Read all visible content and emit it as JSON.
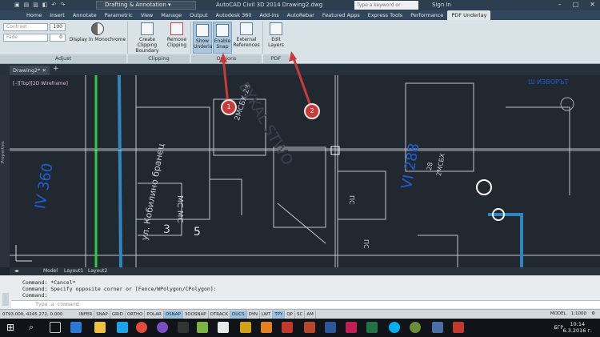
{
  "window": {
    "title": "AutoCAD Civil 3D 2014   Drawing2.dwg",
    "workspace": "Drafting & Annotation",
    "search_placeholder": "Type a keyword or phrase",
    "sign_in": "Sign In"
  },
  "ribbon_tabs": [
    "Home",
    "Insert",
    "Annotate",
    "Parametric",
    "View",
    "Manage",
    "Output",
    "Autodesk 360",
    "Add-ins",
    "AutoRebar",
    "Featured Apps",
    "Express Tools",
    "Performance",
    "PDF Underlay"
  ],
  "ribbon": {
    "adjust": {
      "contrast_label": "Contrast",
      "contrast_value": "100",
      "fade_label": "Fade",
      "fade_value": "0",
      "monochrome_label": "Display in Monochrome",
      "title": "Adjust"
    },
    "clipping": {
      "create_label": "Create Clipping Boundary",
      "remove_label": "Remove Clipping",
      "title": "Clipping"
    },
    "options": {
      "show_underlay_label": "Show Underlay",
      "enable_snap_label": "Enable Snap",
      "external_refs_label": "External References",
      "title": "Options"
    },
    "pdf_layers": {
      "edit_layers_label": "Edit Layers",
      "title": "PDF Layers"
    }
  },
  "document": {
    "tab_label": "Drawing2*",
    "view_label": "[–][Top][2D Wireframe]"
  },
  "drawing_texts": {
    "t1": "2МСБХ-28",
    "t2": "МС МС",
    "t3": "ул. Кобилино бранец",
    "t4": "IV 360",
    "t5": "VI 288",
    "t6": "2МСБХ",
    "t7": "ПС",
    "t8": "ПС",
    "t9": "3",
    "t10": "5",
    "t11": "28",
    "t12": "BYKAL STWO",
    "t13": "Ш ИЗВОРЪТ"
  },
  "markers": [
    "1",
    "2"
  ],
  "layout_tabs": [
    "Model",
    "Layout1",
    "Layout2"
  ],
  "side_panel_label": "Properties",
  "command": {
    "line1": "Command: *Cancel*",
    "line2": "Command: Specify opposite corner or [Fence/WPolygon/CPolygon]:",
    "line3": "Command:",
    "placeholder": "Type a command"
  },
  "status": {
    "coords": "0793.000, 4245.272, 0.000",
    "toggles": [
      "INFER",
      "SNAP",
      "GRID",
      "ORTHO",
      "POLAR",
      "OSNAP",
      "3DOSNAP",
      "OTRACK",
      "DUCS",
      "DYN",
      "LWT",
      "TPY",
      "QP",
      "SC",
      "AM"
    ],
    "active_toggles": [
      "OSNAP",
      "DUCS",
      "TPY"
    ],
    "model": "MODEL",
    "scale": "1:1000"
  },
  "taskbar": {
    "lang": "БГР",
    "time": "10:14",
    "date": "6.3.2016 г."
  },
  "colors": {
    "accent": "#2e86c1",
    "canvas_bg": "#212830",
    "marker": "#c83b3b",
    "blue_text": "#1d5fd6",
    "green_line": "#2ecc40"
  }
}
